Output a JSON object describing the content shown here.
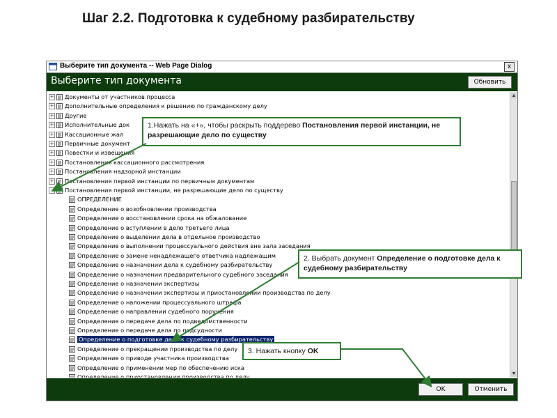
{
  "slide_title": "Шаг 2.2. Подготовка к судебному разбирательству",
  "dialog": {
    "window_title": "Выберите тип документа -- Web Page Dialog",
    "close_glyph": "x",
    "header_title": "Выберите тип документа",
    "refresh_label": "Обновить",
    "ok_label": "OK",
    "cancel_label": "Отменить"
  },
  "tree": {
    "root_items": [
      {
        "label": "Документы от участников процесса",
        "exp": "+"
      },
      {
        "label": "Дополнительные определения к решению по гражданскому делу",
        "exp": "+"
      },
      {
        "label": "Другие",
        "exp": "+"
      },
      {
        "label": "Исполнительные док",
        "exp": "+"
      },
      {
        "label": "Кассационные жал",
        "exp": "+"
      },
      {
        "label": "Первичные документ",
        "exp": "+"
      },
      {
        "label": "Повестки и извещения",
        "exp": "+"
      },
      {
        "label": "Постановления кассационного рассмотрения",
        "exp": "+"
      },
      {
        "label": "Постановления надзорной инстанции",
        "exp": "+"
      },
      {
        "label": "Постановления первой инстанции по первичным документам",
        "exp": "+"
      },
      {
        "label": "Постановления первой инстанции, не разрешающие дело по существу",
        "exp": "-"
      }
    ],
    "child_items": [
      {
        "label": "ОПРЕДЕЛЕНИЕ"
      },
      {
        "label": "Определение о возобновлении производства"
      },
      {
        "label": "Определение о восстановлении срока на обжалование"
      },
      {
        "label": "Определение о вступлении в дело третьего лица"
      },
      {
        "label": "Определение о выделении дела в отдельное производство"
      },
      {
        "label": "Определение о выполнении процессуального действия вне зала заседания"
      },
      {
        "label": "Определение о замене ненадлежащего ответчика надлежащим"
      },
      {
        "label": "Определение о назначении дела к судебному разбирательству"
      },
      {
        "label": "Определение о назначении предварительного судебного заседания"
      },
      {
        "label": "Определение о назначении экспертизы"
      },
      {
        "label": "Определение о назначении экспертизы и приостановлении производства по делу"
      },
      {
        "label": "Определение о наложении процессуального штрафа"
      },
      {
        "label": "Определение о направлении судебного поручения"
      },
      {
        "label": "Определение о передаче дела по подведомственности"
      },
      {
        "label": "Определение о передаче дела по подсудности"
      },
      {
        "label": "Определение о подготовке дела к судебному разбирательству",
        "selected": true
      },
      {
        "label": "Определение о прекращении производства по делу"
      },
      {
        "label": "Определение о приводе участника производства"
      },
      {
        "label": "Определение о применении мер по обеспечению иска"
      },
      {
        "label": "Определение о приостановлении производства по делу"
      }
    ]
  },
  "callouts": {
    "c1_text": "1.Нажать на «+», чтобы раскрыть поддерево ",
    "c1_bold": "Постановления первой инстанции,  не разрешающие дело по существу",
    "c2_text": "2. Выбрать документ ",
    "c2_bold": "Определение о подготовке дела к судебному разбирательству",
    "c3_text": "3. Нажать кнопку ",
    "c3_bold": "OK"
  },
  "colors": {
    "header_bg": "#0d3b0d",
    "callout_border": "#2e7d32",
    "selection_bg": "#0a246a"
  }
}
